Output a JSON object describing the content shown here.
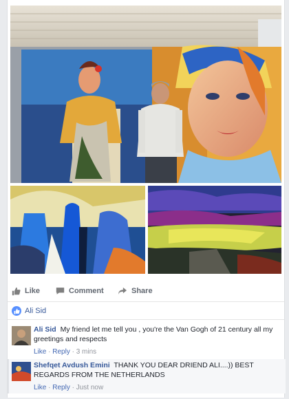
{
  "post": {
    "actions": {
      "like_label": "Like",
      "comment_label": "Comment",
      "share_label": "Share"
    },
    "reactions": {
      "liked_by": "Ali Sid"
    }
  },
  "comments": [
    {
      "author": "Ali Sid",
      "text": "My friend let me tell you , you're the Van Gogh of 21 century all my greetings and respects",
      "like_label": "Like",
      "reply_label": "Reply",
      "time": "3 mins"
    },
    {
      "author": "Shefqet Avdush Emini",
      "text": "THANK YOU DEAR DRIEND ALI....)) BEST REGARDS FROM THE NETHERLANDS",
      "like_label": "Like",
      "reply_label": "Reply",
      "time": "Just now"
    }
  ],
  "colors": {
    "link": "#365899",
    "meta": "#90949c",
    "action": "#616770",
    "like_badge": "#5890ff"
  },
  "icons": [
    "like-thumb-icon",
    "comment-icon",
    "share-arrow-icon",
    "like-badge-icon"
  ]
}
